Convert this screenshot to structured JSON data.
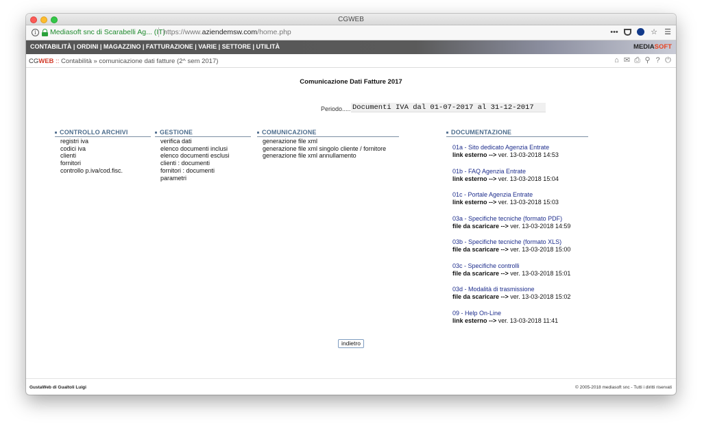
{
  "window": {
    "title": "CGWEB"
  },
  "urlbar": {
    "site_identity": "Mediasoft snc di Scarabelli Ag... (IT)",
    "url_prefix": "https://www.",
    "url_domain": "aziendemsw.com",
    "url_path": "/home.php"
  },
  "menu": {
    "items": [
      "CONTABILITÀ",
      "ORDINI",
      "MAGAZZINO",
      "FATTURAZIONE",
      "VARIE",
      "SETTORE",
      "UTILITÀ"
    ],
    "separator": " | ",
    "brand_left": "MEDIA",
    "brand_right": "SOFT"
  },
  "breadcrumb": {
    "app_cg": "CG",
    "app_web": "WEB",
    "sep": " :: ",
    "trail": "Contabilità » comunicazione dati fatture (2^ sem 2017)"
  },
  "page": {
    "heading": "Comunicazione Dati Fatture 2017",
    "periodo_label": "Periodo.....:",
    "periodo_value": "Documenti IVA dal 01-07-2017 al 31-12-2017"
  },
  "sections": {
    "controllo": {
      "title": "CONTROLLO ARCHIVI",
      "items": [
        "registri iva",
        "codici iva",
        "clienti",
        "fornitori",
        "controllo p.iva/cod.fisc."
      ]
    },
    "gestione": {
      "title": "GESTIONE",
      "items": [
        "verifica dati",
        "elenco documenti inclusi",
        "elenco documenti esclusi",
        "clienti : documenti",
        "fornitori : documenti",
        "parametri"
      ]
    },
    "comunicazione": {
      "title": "COMUNICAZIONE",
      "items": [
        "generazione file xml",
        "generazione file xml singolo cliente / fornitore",
        "generazione file xml annullamento"
      ]
    },
    "documentazione": {
      "title": "DOCUMENTAZIONE",
      "items": [
        {
          "title": "01a - Sito dedicato Agenzia Entrate",
          "kind": "link esterno -->",
          "version": "ver. 13-03-2018 14:53"
        },
        {
          "title": "01b - FAQ Agenzia Entrate",
          "kind": "link esterno -->",
          "version": "ver. 13-03-2018 15:04"
        },
        {
          "title": "01c - Portale Agenzia Entrate",
          "kind": "link esterno -->",
          "version": "ver. 13-03-2018 15:03"
        },
        {
          "title": "03a - Specifiche tecniche (formato PDF)",
          "kind": "file da scaricare -->",
          "version": "ver. 13-03-2018 14:59"
        },
        {
          "title": "03b - Specifiche tecniche (formato XLS)",
          "kind": "file da scaricare -->",
          "version": "ver. 13-03-2018 15:00"
        },
        {
          "title": "03c - Specifiche controlli",
          "kind": "file da scaricare -->",
          "version": "ver. 13-03-2018 15:01"
        },
        {
          "title": "03d - Modalità di trasmissione",
          "kind": "file da scaricare -->",
          "version": "ver. 13-03-2018 15:02"
        },
        {
          "title": "09 - Help On-Line",
          "kind": "link esterno -->",
          "version": "ver. 13-03-2018 11:41"
        }
      ]
    }
  },
  "back_button": {
    "label": "indietro"
  },
  "footer": {
    "left": "GustaWeb di Gualtoli Luigi",
    "right": "© 2005-2018 mediasoft snc - Tutti i diritti riservati"
  },
  "colors": {
    "menubar": "#555555",
    "brand_accent": "#e8421f",
    "section_head": "#4c6c8c",
    "doc_link": "#1d2d8c",
    "secure_green": "#1f8a2e"
  },
  "icons": {
    "urlbar": [
      "info-icon",
      "lock-icon",
      "more-icon",
      "pocket-icon",
      "shield-icon",
      "star-icon",
      "hamburger-menu-icon"
    ],
    "toolbar": [
      "home-icon",
      "mail-icon",
      "print-icon",
      "search-icon",
      "help-icon",
      "power-icon"
    ]
  }
}
